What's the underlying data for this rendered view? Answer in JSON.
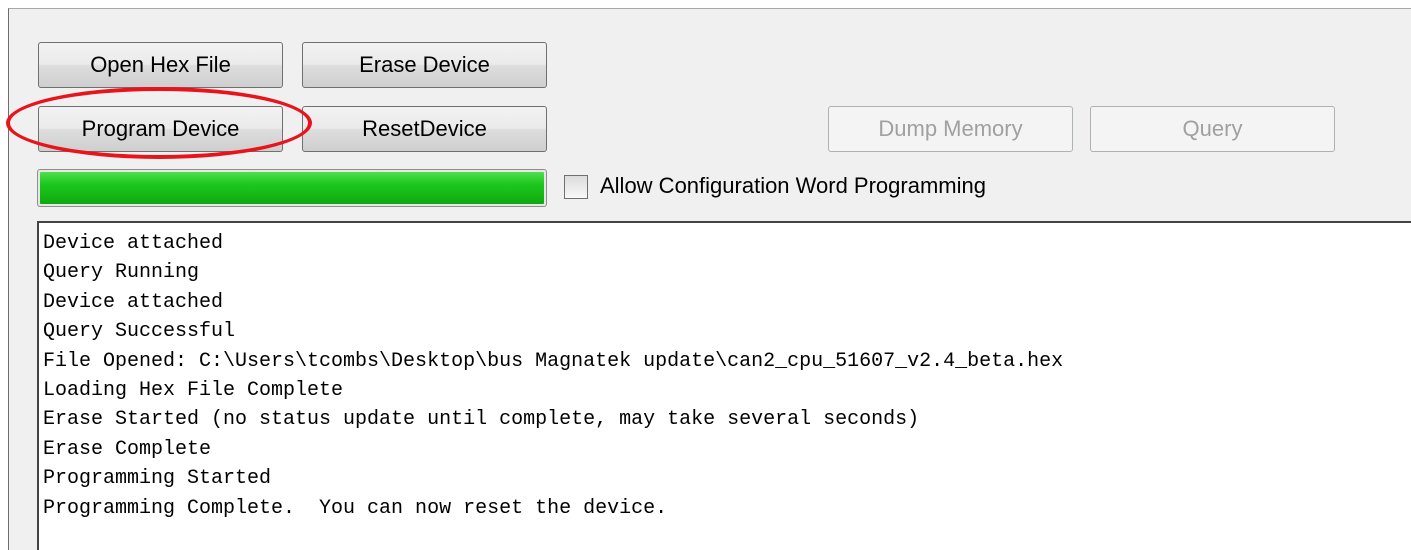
{
  "buttons": {
    "open_hex": "Open Hex File",
    "erase": "Erase Device",
    "program": "Program Device",
    "reset": "ResetDevice",
    "dump": "Dump Memory",
    "query": "Query"
  },
  "progress": {
    "fraction": 1.0,
    "color": "#1fc41f"
  },
  "config_checkbox": {
    "label": "Allow Configuration Word Programming",
    "checked": false
  },
  "highlight_color": "#e8141b",
  "log": [
    "Device attached",
    "Query Running",
    "Device attached",
    "Query Successful",
    "File Opened: C:\\Users\\tcombs\\Desktop\\bus Magnatek update\\can2_cpu_51607_v2.4_beta.hex",
    "Loading Hex File Complete",
    "Erase Started (no status update until complete, may take several seconds)",
    "Erase Complete",
    "Programming Started",
    "Programming Complete.  You can now reset the device."
  ]
}
